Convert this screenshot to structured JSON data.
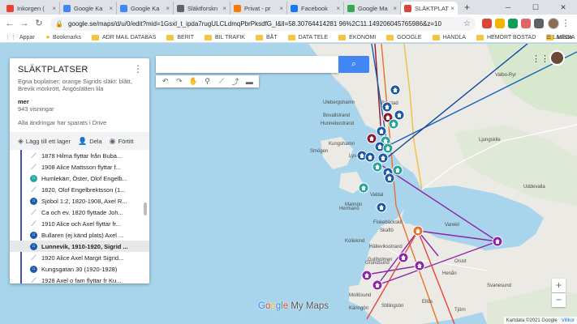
{
  "browser": {
    "tabs": [
      {
        "label": "Inkorgen (",
        "favicon_color": "#ea4335"
      },
      {
        "label": "Google Ka",
        "favicon_color": "#4285f4"
      },
      {
        "label": "Google Ka",
        "favicon_color": "#4285f4"
      },
      {
        "label": "Släktforskn",
        "favicon_color": "#5f6368"
      },
      {
        "label": "Privat - pr",
        "favicon_color": "#f57c00"
      },
      {
        "label": "Facebook",
        "favicon_color": "#1877f2"
      },
      {
        "label": "Google Ma",
        "favicon_color": "#34a853"
      },
      {
        "label": "SLÄKTPLAT",
        "favicon_color": "#db4437"
      }
    ],
    "url": "google.se/maps/d/u/0/edit?mid=1Gsxl_t_ipda7rugULCLdmqPbrPksdfG_I&ll=58.30764414281 96%2C11.149206045765986&z=10"
  },
  "bookmarks": {
    "apps": "Appar",
    "bookmarks": "Bookmarks",
    "folders": [
      "ADR MAIL DATABAS",
      "BERIT",
      "BIL TRAFIK",
      "BÅT",
      "DATA TELE",
      "EKONOMI",
      "GOOGLE",
      "HANDLA",
      "HEMORT BOSTAD",
      "MEDIA"
    ],
    "reading_list": "Läslista"
  },
  "panel": {
    "title": "SLÄKTPLATSER",
    "description": "Egna boplatser: orange Sigrids släkt: blått, Brevik mörkrött, Ängöslätten lila",
    "more": "mer",
    "views": "943 visningar",
    "saved": "Alla ändringar har sparats i Drive",
    "add_layer": "Lägg till ett lager",
    "share": "Dela",
    "preview": "Förtitt"
  },
  "layer_items": [
    {
      "label": "1878 Hilma flyttar från Buba...",
      "icon": "line",
      "color": "#4a7ab5",
      "selected": false
    },
    {
      "label": "1908 Alice Mattsson flyttar f...",
      "icon": "line",
      "color": "#4a7ab5",
      "selected": false
    },
    {
      "label": "Humlekärr, Öster, Olof Engelb...",
      "icon": "dot",
      "color": "#26a69a",
      "selected": false
    },
    {
      "label": "1820, Olof Engelbrektsson (1...",
      "icon": "line",
      "color": "#4a7ab5",
      "selected": false
    },
    {
      "label": "Sjöbol 1:2, 1820-1908, Axel R...",
      "icon": "dot",
      "color": "#1a5aa6",
      "selected": false
    },
    {
      "label": "Ca och ev. 1820 flyttade Joh...",
      "icon": "line",
      "color": "#4a7ab5",
      "selected": false
    },
    {
      "label": "1910 Alice och Axel flyttar fr...",
      "icon": "line",
      "color": "#4a7ab5",
      "selected": false
    },
    {
      "label": "Bullaren (ej känd plats) Axel ...",
      "icon": "dot",
      "color": "#1a5aa6",
      "selected": false
    },
    {
      "label": "Lunnevik, 1910-1920, Sigrid ...",
      "icon": "dot",
      "color": "#1a5aa6",
      "selected": true
    },
    {
      "label": "1920 Alice Axel Margit Sigrid...",
      "icon": "line",
      "color": "#4a7ab5",
      "selected": false
    },
    {
      "label": "Kungsgatan 30 (1920-1928)",
      "icon": "dot",
      "color": "#1a5aa6",
      "selected": false
    },
    {
      "label": "1928 Axel o fam flyttar fr Ku...",
      "icon": "line",
      "color": "#4a7ab5",
      "selected": false
    }
  ],
  "map": {
    "labels": [
      {
        "text": "Valbo-Ryr",
        "color": "#4a4a4a"
      },
      {
        "text": "Uddevalla",
        "color": "#4a4a4a"
      },
      {
        "text": "Ljungskile",
        "color": "#4a4a4a"
      },
      {
        "text": "Henån",
        "color": "#4a4a4a"
      },
      {
        "text": "Svanesund",
        "color": "#4a4a4a"
      },
      {
        "text": "Orust",
        "color": "#4a4a4a"
      },
      {
        "text": "Skaftö",
        "color": "#4a4a4a"
      },
      {
        "text": "Grundsund",
        "color": "#4a4a4a"
      },
      {
        "text": "Fiskebäckskil",
        "color": "#4a4a4a"
      },
      {
        "text": "Lysekil",
        "color": "#4a4a4a"
      },
      {
        "text": "Brastad",
        "color": "#4a4a4a"
      },
      {
        "text": "Smögen",
        "color": "#4a4a4a"
      },
      {
        "text": "Hunnebostrand",
        "color": "#4a4a4a"
      },
      {
        "text": "Bovallstrand",
        "color": "#4a4a4a"
      },
      {
        "text": "Ulebergshamn",
        "color": "#4a4a4a"
      },
      {
        "text": "Gullholmen",
        "color": "#4a4a4a"
      },
      {
        "text": "Käringön",
        "color": "#4a4a4a"
      },
      {
        "text": "Hermanö",
        "color": "#4a4a4a"
      },
      {
        "text": "Stillingsön",
        "color": "#4a4a4a"
      },
      {
        "text": "Varekil",
        "color": "#4a4a4a"
      },
      {
        "text": "Kungshamn",
        "color": "#4a4a4a"
      },
      {
        "text": "Malmön",
        "color": "#4a4a4a"
      },
      {
        "text": "Valdal",
        "color": "#4a4a4a"
      },
      {
        "text": "Kollekind",
        "color": "#4a4a4a"
      },
      {
        "text": "Ellös",
        "color": "#4a4a4a"
      },
      {
        "text": "Mollösund",
        "color": "#4a4a4a"
      },
      {
        "text": "Hälleviksstrand",
        "color": "#4a4a4a"
      },
      {
        "text": "Tjörn",
        "color": "#4a4a4a"
      }
    ],
    "branding": {
      "google": "Google",
      "mymaps": " My Maps"
    },
    "attribution": "Kartdata ©2021 Google",
    "terms": "Villkor",
    "zoom_in": "+",
    "zoom_out": "−"
  },
  "colors": {
    "orange": "#e8712a",
    "blue": "#1a5aa6",
    "darkred": "#8b1a2b",
    "purple": "#8e24aa",
    "teal": "#26a69a",
    "line_blue": "#1565c0",
    "line_darkblue": "#0d47a1"
  }
}
